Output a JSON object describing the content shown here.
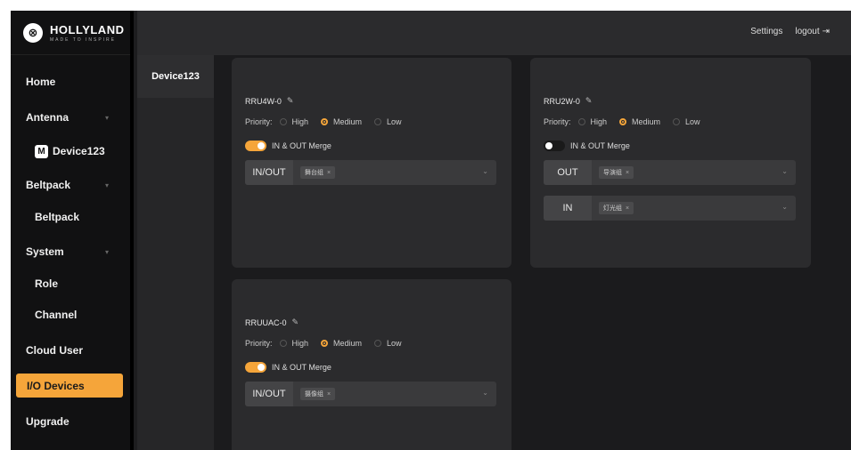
{
  "brand": {
    "name": "HOLLYLAND",
    "tagline": "MADE TO INSPIRE"
  },
  "topbar": {
    "settings": "Settings",
    "logout": "logout"
  },
  "sidebar": {
    "items": [
      {
        "label": "Home"
      },
      {
        "label": "Antenna"
      },
      {
        "label": "Device123",
        "badge": "M"
      },
      {
        "label": "Beltpack"
      },
      {
        "label": "Beltpack"
      },
      {
        "label": "System"
      },
      {
        "label": "Role"
      },
      {
        "label": "Channel"
      },
      {
        "label": "Cloud User"
      },
      {
        "label": "I/O Devices"
      },
      {
        "label": "Upgrade"
      }
    ]
  },
  "device_tab": "Device123",
  "priority_label": "Priority:",
  "priority_options": [
    "High",
    "Medium",
    "Low"
  ],
  "merge_label": "IN & OUT Merge",
  "cards": [
    {
      "name": "RRU4W-0",
      "priority": "Medium",
      "merge": true,
      "rows": [
        {
          "label": "IN/OUT",
          "chip": "舞台组"
        }
      ]
    },
    {
      "name": "RRU2W-0",
      "priority": "Medium",
      "merge": false,
      "rows": [
        {
          "label": "OUT",
          "chip": "导演组"
        },
        {
          "label": "IN",
          "chip": "灯光组"
        }
      ]
    },
    {
      "name": "RRUUAC-0",
      "priority": "Medium",
      "merge": true,
      "rows": [
        {
          "label": "IN/OUT",
          "chip": "摄像组"
        }
      ]
    }
  ],
  "colors": {
    "accent": "#f5a53a",
    "sidebar_bg": "#111112",
    "card_bg": "#2b2b2d"
  }
}
